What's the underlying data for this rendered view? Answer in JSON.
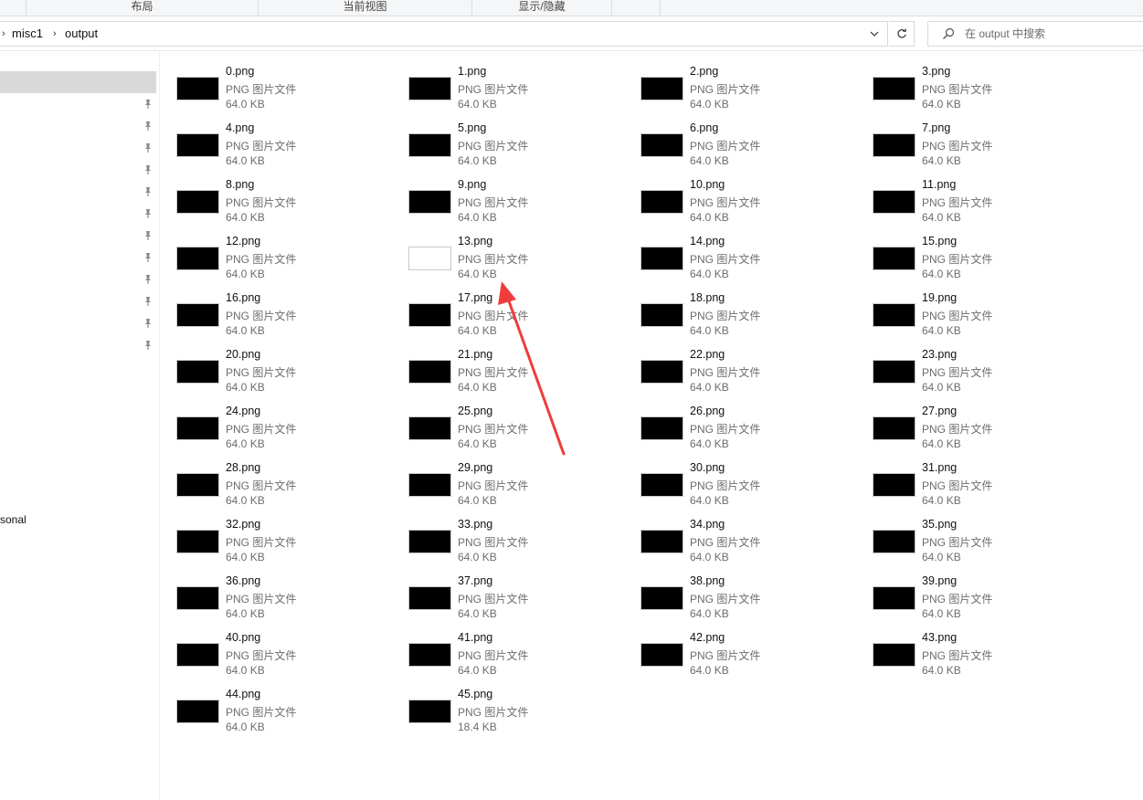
{
  "ribbon": {
    "groups": [
      {
        "label": "布局"
      },
      {
        "label": "当前视图"
      },
      {
        "label": "显示/隐藏"
      }
    ]
  },
  "address_bar": {
    "breadcrumbs": [
      {
        "label": "misc1"
      },
      {
        "label": "output"
      }
    ]
  },
  "search": {
    "placeholder": "在 output 中搜索",
    "icon": "search-icon"
  },
  "nav": {
    "partial_item": "sonal",
    "pin_icon": "pin-icon"
  },
  "accent_colors": {
    "annotation_arrow": "#f03c3c",
    "thumbnail": "#000000",
    "selected_nav": "#d9d9d9"
  },
  "files": [
    {
      "name": "0.png",
      "type": "PNG 图片文件",
      "size": "64.0 KB"
    },
    {
      "name": "1.png",
      "type": "PNG 图片文件",
      "size": "64.0 KB"
    },
    {
      "name": "2.png",
      "type": "PNG 图片文件",
      "size": "64.0 KB"
    },
    {
      "name": "3.png",
      "type": "PNG 图片文件",
      "size": "64.0 KB"
    },
    {
      "name": "4.png",
      "type": "PNG 图片文件",
      "size": "64.0 KB"
    },
    {
      "name": "5.png",
      "type": "PNG 图片文件",
      "size": "64.0 KB"
    },
    {
      "name": "6.png",
      "type": "PNG 图片文件",
      "size": "64.0 KB"
    },
    {
      "name": "7.png",
      "type": "PNG 图片文件",
      "size": "64.0 KB"
    },
    {
      "name": "8.png",
      "type": "PNG 图片文件",
      "size": "64.0 KB"
    },
    {
      "name": "9.png",
      "type": "PNG 图片文件",
      "size": "64.0 KB"
    },
    {
      "name": "10.png",
      "type": "PNG 图片文件",
      "size": "64.0 KB"
    },
    {
      "name": "11.png",
      "type": "PNG 图片文件",
      "size": "64.0 KB"
    },
    {
      "name": "12.png",
      "type": "PNG 图片文件",
      "size": "64.0 KB"
    },
    {
      "name": "13.png",
      "type": "PNG 图片文件",
      "size": "64.0 KB",
      "thumbnail": "white"
    },
    {
      "name": "14.png",
      "type": "PNG 图片文件",
      "size": "64.0 KB"
    },
    {
      "name": "15.png",
      "type": "PNG 图片文件",
      "size": "64.0 KB"
    },
    {
      "name": "16.png",
      "type": "PNG 图片文件",
      "size": "64.0 KB"
    },
    {
      "name": "17.png",
      "type": "PNG 图片文件",
      "size": "64.0 KB"
    },
    {
      "name": "18.png",
      "type": "PNG 图片文件",
      "size": "64.0 KB"
    },
    {
      "name": "19.png",
      "type": "PNG 图片文件",
      "size": "64.0 KB"
    },
    {
      "name": "20.png",
      "type": "PNG 图片文件",
      "size": "64.0 KB"
    },
    {
      "name": "21.png",
      "type": "PNG 图片文件",
      "size": "64.0 KB"
    },
    {
      "name": "22.png",
      "type": "PNG 图片文件",
      "size": "64.0 KB"
    },
    {
      "name": "23.png",
      "type": "PNG 图片文件",
      "size": "64.0 KB"
    },
    {
      "name": "24.png",
      "type": "PNG 图片文件",
      "size": "64.0 KB"
    },
    {
      "name": "25.png",
      "type": "PNG 图片文件",
      "size": "64.0 KB"
    },
    {
      "name": "26.png",
      "type": "PNG 图片文件",
      "size": "64.0 KB"
    },
    {
      "name": "27.png",
      "type": "PNG 图片文件",
      "size": "64.0 KB"
    },
    {
      "name": "28.png",
      "type": "PNG 图片文件",
      "size": "64.0 KB"
    },
    {
      "name": "29.png",
      "type": "PNG 图片文件",
      "size": "64.0 KB"
    },
    {
      "name": "30.png",
      "type": "PNG 图片文件",
      "size": "64.0 KB"
    },
    {
      "name": "31.png",
      "type": "PNG 图片文件",
      "size": "64.0 KB"
    },
    {
      "name": "32.png",
      "type": "PNG 图片文件",
      "size": "64.0 KB"
    },
    {
      "name": "33.png",
      "type": "PNG 图片文件",
      "size": "64.0 KB"
    },
    {
      "name": "34.png",
      "type": "PNG 图片文件",
      "size": "64.0 KB"
    },
    {
      "name": "35.png",
      "type": "PNG 图片文件",
      "size": "64.0 KB"
    },
    {
      "name": "36.png",
      "type": "PNG 图片文件",
      "size": "64.0 KB"
    },
    {
      "name": "37.png",
      "type": "PNG 图片文件",
      "size": "64.0 KB"
    },
    {
      "name": "38.png",
      "type": "PNG 图片文件",
      "size": "64.0 KB"
    },
    {
      "name": "39.png",
      "type": "PNG 图片文件",
      "size": "64.0 KB"
    },
    {
      "name": "40.png",
      "type": "PNG 图片文件",
      "size": "64.0 KB"
    },
    {
      "name": "41.png",
      "type": "PNG 图片文件",
      "size": "64.0 KB"
    },
    {
      "name": "42.png",
      "type": "PNG 图片文件",
      "size": "64.0 KB"
    },
    {
      "name": "43.png",
      "type": "PNG 图片文件",
      "size": "64.0 KB"
    },
    {
      "name": "44.png",
      "type": "PNG 图片文件",
      "size": "64.0 KB"
    },
    {
      "name": "45.png",
      "type": "PNG 图片文件",
      "size": "18.4 KB"
    }
  ]
}
